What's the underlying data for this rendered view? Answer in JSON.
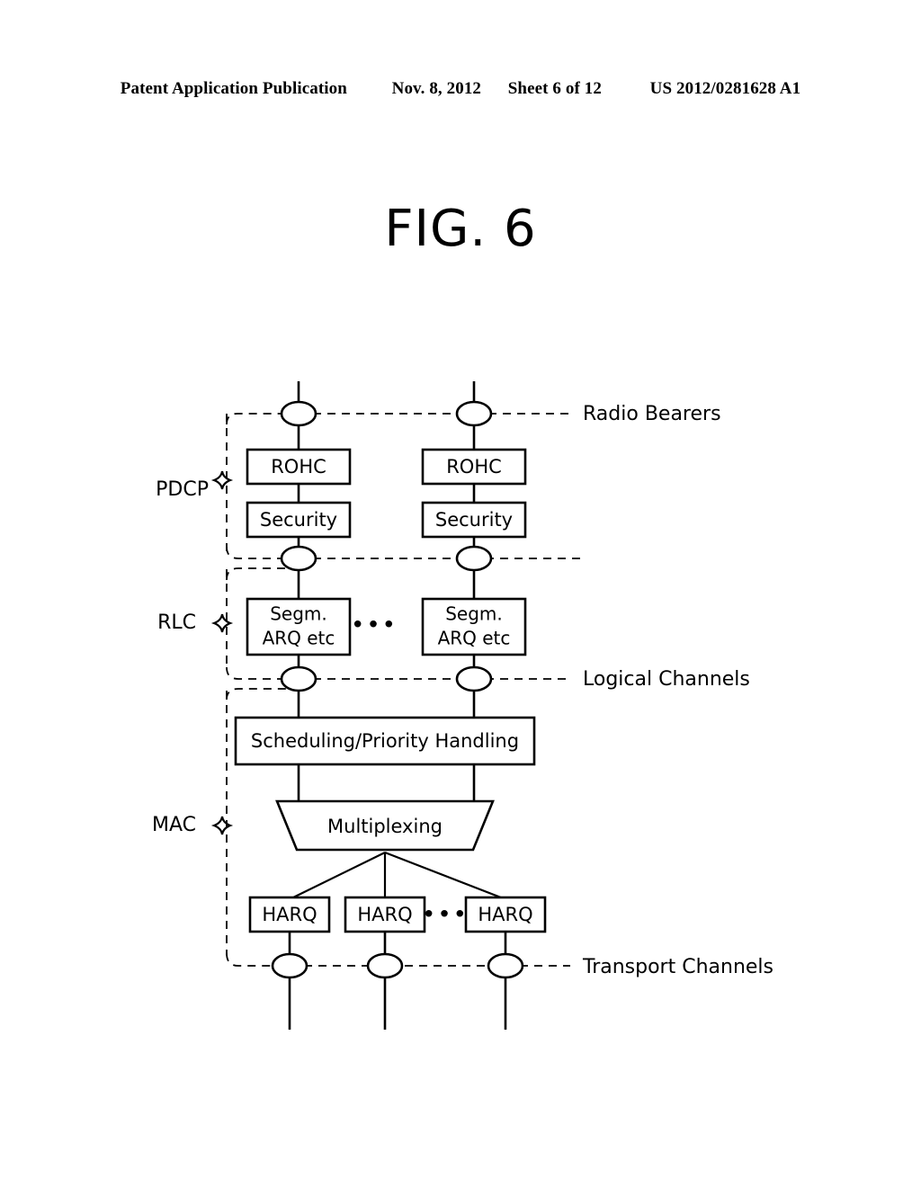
{
  "header": {
    "publication": "Patent Application Publication",
    "date": "Nov. 8, 2012",
    "sheet": "Sheet 6 of 12",
    "patent_number": "US 2012/0281628 A1"
  },
  "figure": {
    "title": "FIG. 6"
  },
  "layers": [
    {
      "id": "pdcp",
      "label": "PDCP"
    },
    {
      "id": "rlc",
      "label": "RLC"
    },
    {
      "id": "mac",
      "label": "MAC"
    }
  ],
  "channel_labels": [
    {
      "id": "radio-bearers",
      "label": "Radio Bearers"
    },
    {
      "id": "logical-channels",
      "label": "Logical Channels"
    },
    {
      "id": "transport-channels",
      "label": "Transport Channels"
    }
  ],
  "blocks": {
    "rohc_left": "ROHC",
    "rohc_right": "ROHC",
    "security_left": "Security",
    "security_right": "Security",
    "rlc_left_line1": "Segm.",
    "rlc_left_line2": "ARQ etc",
    "rlc_right_line1": "Segm.",
    "rlc_right_line2": "ARQ etc",
    "scheduling": "Scheduling/Priority Handling",
    "multiplexing": "Multiplexing",
    "harq_1": "HARQ",
    "harq_2": "HARQ",
    "harq_3": "HARQ"
  },
  "ellipsis": {
    "rlc": "•••",
    "harq": "•••"
  },
  "colors": {
    "ink": "#000000",
    "paper": "#ffffff"
  }
}
